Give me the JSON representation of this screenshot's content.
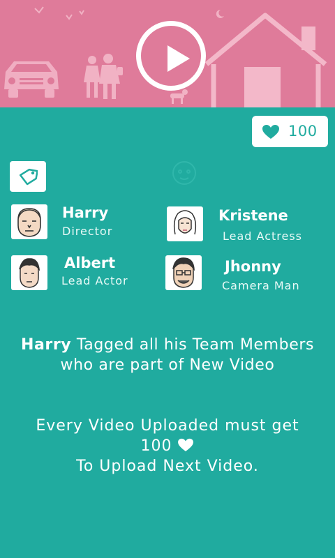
{
  "hero": {
    "play_icon": "play-icon"
  },
  "likes": {
    "count": "100",
    "icon": "heart-icon"
  },
  "tag": {
    "icon": "tag-icon"
  },
  "members": [
    {
      "name": "Harry",
      "role": "Director"
    },
    {
      "name": "Kristene",
      "role": "Lead Actress"
    },
    {
      "name": "Albert",
      "role": "Lead Actor"
    },
    {
      "name": "Jhonny",
      "role": "Camera Man"
    }
  ],
  "message": {
    "user": "Harry",
    "line1_rest": "Tagged all his Team Members",
    "line2": "who are part of New Video"
  },
  "rule": {
    "line1": "Every Video Uploaded must get",
    "count": "100",
    "line3": "To Upload Next Video."
  },
  "colors": {
    "hero_pink": "#df7b9a",
    "teal": "#20ab9f",
    "white": "#ffffff"
  }
}
